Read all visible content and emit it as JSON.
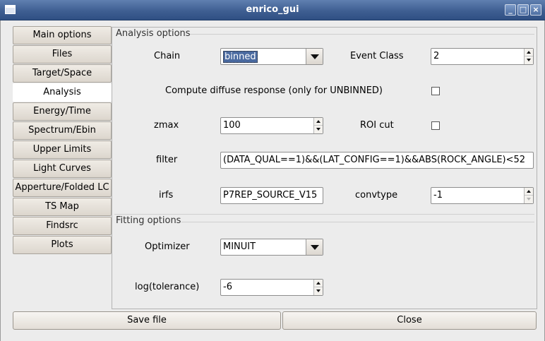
{
  "window": {
    "title": "enrico_gui"
  },
  "sidebar": {
    "items": [
      {
        "label": "Main options"
      },
      {
        "label": "Files"
      },
      {
        "label": "Target/Space"
      },
      {
        "label": "Analysis"
      },
      {
        "label": "Energy/Time"
      },
      {
        "label": "Spectrum/Ebin"
      },
      {
        "label": "Upper Limits"
      },
      {
        "label": "Light Curves"
      },
      {
        "label": "Apperture/Folded LC"
      },
      {
        "label": "TS Map"
      },
      {
        "label": "Findsrc"
      },
      {
        "label": "Plots"
      }
    ],
    "active": "Analysis"
  },
  "analysis": {
    "group_title": "Analysis options",
    "chain": {
      "label": "Chain",
      "value": "binned"
    },
    "event_class": {
      "label": "Event Class",
      "value": "2"
    },
    "diffuse": {
      "label": "Compute diffuse response (only for UNBINNED)",
      "checked": false
    },
    "zmax": {
      "label": "zmax",
      "value": "100"
    },
    "roi_cut": {
      "label": "ROI cut",
      "checked": false
    },
    "filter": {
      "label": "filter",
      "value": "(DATA_QUAL==1)&&(LAT_CONFIG==1)&&ABS(ROCK_ANGLE)<52"
    },
    "irfs": {
      "label": "irfs",
      "value": "P7REP_SOURCE_V15"
    },
    "convtype": {
      "label": "convtype",
      "value": "-1"
    }
  },
  "fitting": {
    "group_title": "Fitting options",
    "optimizer": {
      "label": "Optimizer",
      "value": "MINUIT"
    },
    "tolerance": {
      "label": "log(tolerance)",
      "value": "-6"
    }
  },
  "footer": {
    "save_label": "Save file",
    "close_label": "Close"
  },
  "colors": {
    "titlebar": "#3f5f92",
    "selection": "#4a6aa0",
    "background": "#ececec"
  }
}
